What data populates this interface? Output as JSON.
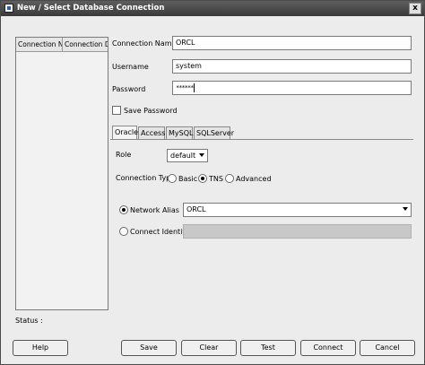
{
  "window": {
    "title": "New / Select Database Connection",
    "close": "x"
  },
  "list": {
    "columns": [
      "Connection N...",
      "Connection D..."
    ]
  },
  "form": {
    "connection_name_label": "Connection Name",
    "connection_name_value": "ORCL",
    "username_label": "Username",
    "username_value": "system",
    "password_label": "Password",
    "password_value": "******",
    "save_password_label": "Save Password",
    "save_password_checked": false
  },
  "tabs": [
    "Oracle",
    "Access",
    "MySQL",
    "SQLServer"
  ],
  "active_tab": "Oracle",
  "oracle": {
    "role_label": "Role",
    "role_value": "default",
    "connection_type_label": "Connection Type",
    "connection_types": [
      "Basic",
      "TNS",
      "Advanced"
    ],
    "connection_type_selected": "TNS",
    "network_alias_label": "Network Alias",
    "network_alias_value": "ORCL",
    "connect_identifier_label": "Connect Identifier"
  },
  "status": {
    "label": "Status :"
  },
  "buttons": {
    "help": "Help",
    "save": "Save",
    "clear": "Clear",
    "test": "Test",
    "connect": "Connect",
    "cancel": "Cancel"
  }
}
